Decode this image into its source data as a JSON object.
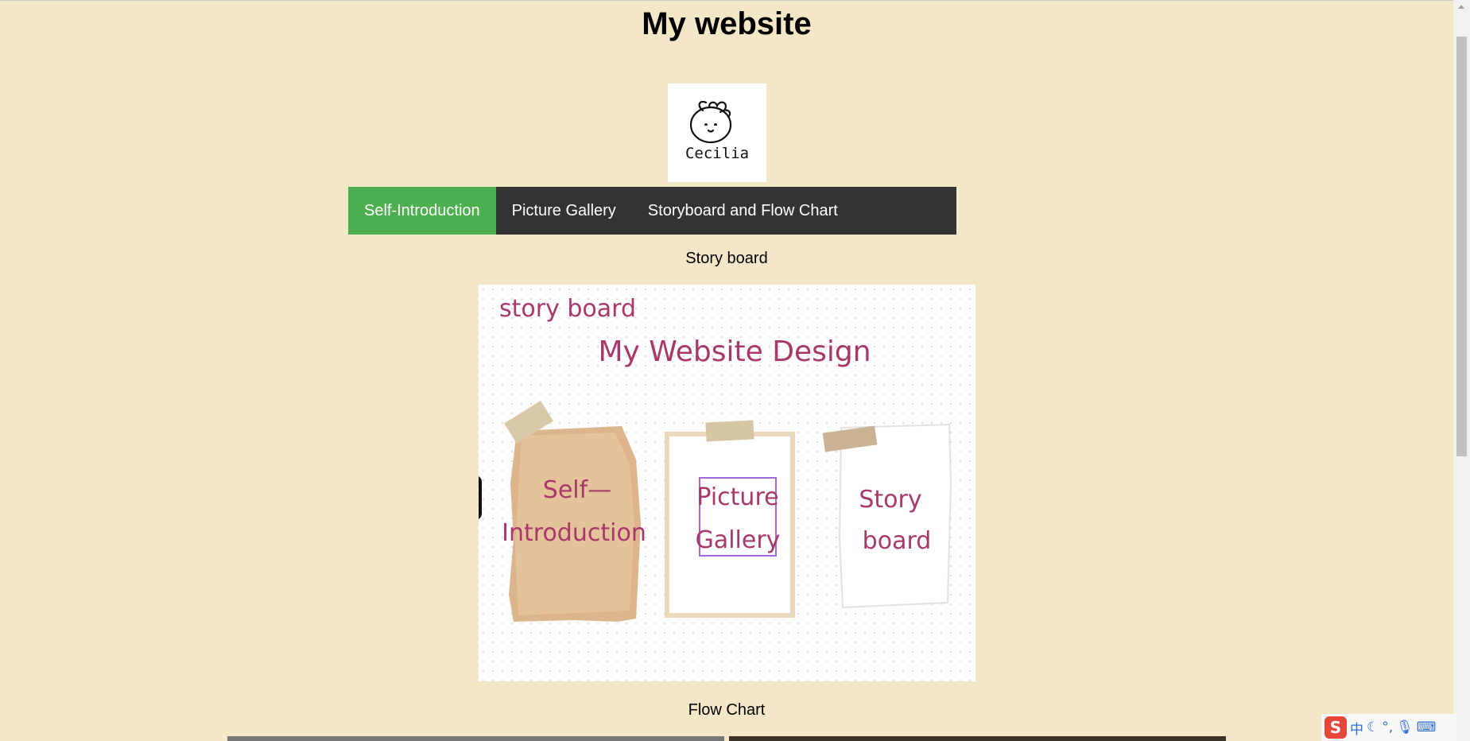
{
  "header": {
    "title": "My website"
  },
  "logo": {
    "text": "Cecilia"
  },
  "nav": {
    "items": [
      {
        "label": "Self-Introduction",
        "active": true
      },
      {
        "label": "Picture Gallery",
        "active": false
      },
      {
        "label": "Storyboard and Flow Chart",
        "active": false
      }
    ],
    "active_color": "#4caf50",
    "bar_color": "#333333"
  },
  "sections": {
    "storyboard_caption": "Story board",
    "flowchart_caption": "Flow Chart"
  },
  "storyboard_image": {
    "corner_label": "story board",
    "heading": "My Website Design",
    "cards": [
      {
        "line1": "Self—",
        "line2": "Introduction"
      },
      {
        "line1": "Picture",
        "line2": "Gallery"
      },
      {
        "line1": "Story",
        "line2": "board"
      }
    ],
    "text_color": "#a8386a"
  },
  "ime": {
    "logo": "S",
    "mode": "中",
    "icons": [
      "moon-icon",
      "punctuation-icon",
      "microphone-icon",
      "keyboard-icon"
    ]
  }
}
